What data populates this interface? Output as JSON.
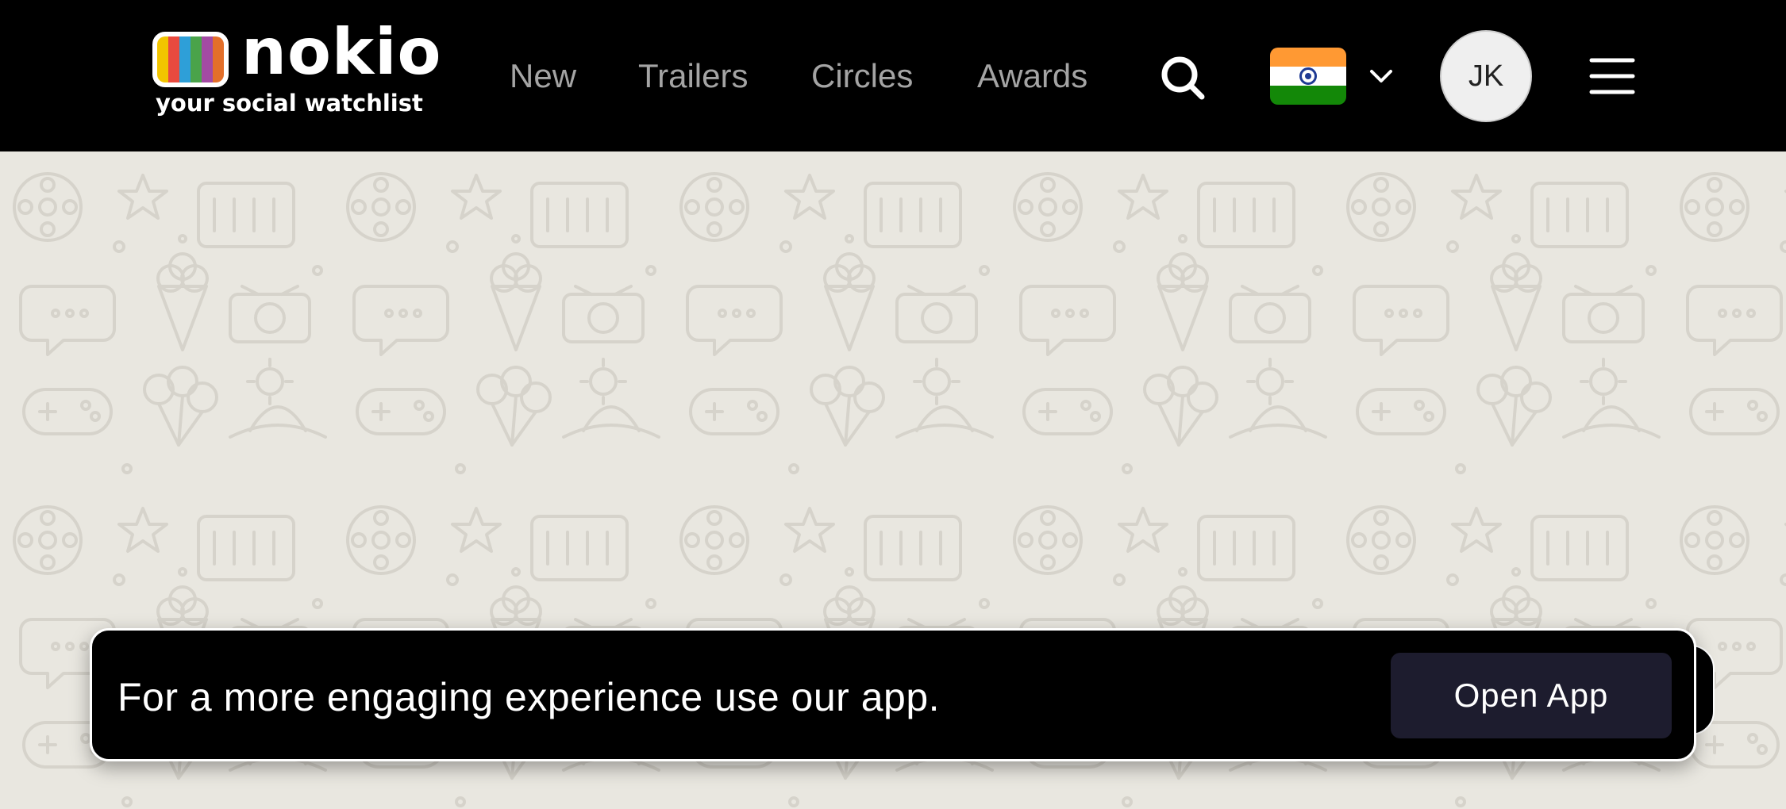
{
  "header": {
    "logo": {
      "wordmark": "nokio",
      "tagline": "your social watchlist",
      "tv_colors": [
        "#f2c500",
        "#e94a3f",
        "#2e9fd8",
        "#4aa34a",
        "#a34aa3",
        "#e36f2a"
      ]
    },
    "nav": [
      {
        "label": "New"
      },
      {
        "label": "Trailers"
      },
      {
        "label": "Circles"
      },
      {
        "label": "Awards"
      }
    ],
    "search_icon": "search-icon",
    "country_flag": {
      "icon": "india-flag-icon",
      "colors": [
        "#ff9933",
        "#ffffff",
        "#138808"
      ],
      "chakra_color": "#1f3a93"
    },
    "dropdown_icon": "chevron-down-icon",
    "avatar_initials": "JK",
    "menu_icon": "hamburger-menu-icon"
  },
  "background": {
    "color": "#e9e7e0",
    "doodle_color": "#d6d3cb"
  },
  "banner": {
    "text": "For a more engaging experience use our app.",
    "button_label": "Open App",
    "button_color": "#1d1c2e"
  }
}
